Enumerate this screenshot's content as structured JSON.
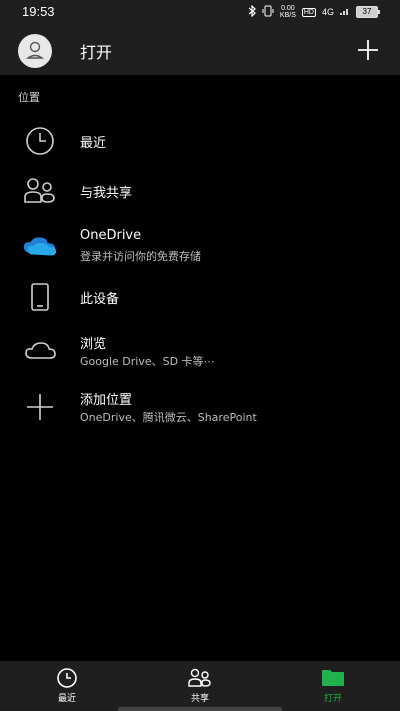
{
  "status_bar": {
    "time": "19:53",
    "net_speed_top": "0.00",
    "net_speed_bottom": "KB/S",
    "hd_label": "HD",
    "network": "4G",
    "battery": "37"
  },
  "header": {
    "title": "打开"
  },
  "section": {
    "label": "位置"
  },
  "locations": [
    {
      "title": "最近",
      "subtitle": "",
      "icon": "clock-icon"
    },
    {
      "title": "与我共享",
      "subtitle": "",
      "icon": "people-icon"
    },
    {
      "title": "OneDrive",
      "subtitle": "登录并访问你的免费存储",
      "icon": "onedrive-cloud-icon"
    },
    {
      "title": "此设备",
      "subtitle": "",
      "icon": "phone-icon"
    },
    {
      "title": "浏览",
      "subtitle": "Google Drive、SD 卡等⋯",
      "icon": "cloud-outline-icon"
    },
    {
      "title": "添加位置",
      "subtitle": "OneDrive、腾讯微云、SharePoint",
      "icon": "plus-icon"
    }
  ],
  "bottom_nav": {
    "items": [
      {
        "label": "最近",
        "icon": "clock-icon",
        "active": false
      },
      {
        "label": "共享",
        "icon": "people-icon",
        "active": false
      },
      {
        "label": "打开",
        "icon": "folder-icon",
        "active": true
      }
    ]
  },
  "colors": {
    "background": "#000000",
    "bar": "#1f1f1f",
    "accent": "#21b14c",
    "onedrive_blue": "#1f84d8"
  }
}
